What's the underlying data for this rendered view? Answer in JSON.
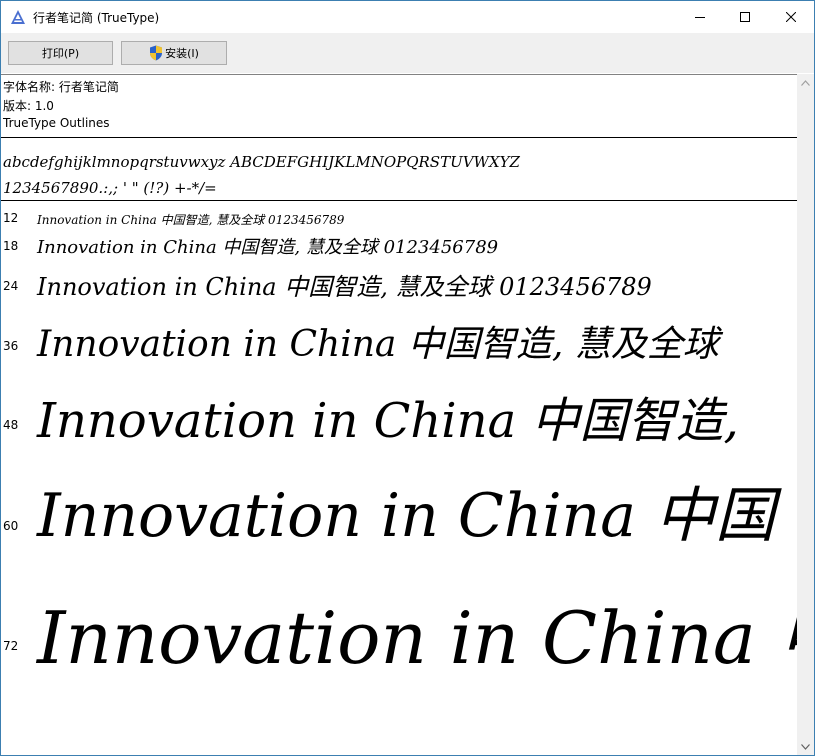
{
  "window": {
    "title": "行者笔记简 (TrueType)",
    "accent_color": "#3c7fb1"
  },
  "toolbar": {
    "print_label": "打印(P)",
    "install_label": "安装(I)"
  },
  "info": {
    "font_name": "字体名称: 行者笔记简",
    "version": "版本: 1.0",
    "outline_type": "TrueType Outlines"
  },
  "charset": {
    "alphabet": "abcdefghijklmnopqrstuvwxyz ABCDEFGHIJKLMNOPQRSTUVWXYZ",
    "digits": "1234567890.:,; ' \" (!?) +-*/="
  },
  "samples": [
    {
      "size": "12",
      "text": "Innovation in China 中国智造, 慧及全球 0123456789"
    },
    {
      "size": "18",
      "text": "Innovation in China 中国智造, 慧及全球 0123456789"
    },
    {
      "size": "24",
      "text": "Innovation in China 中国智造, 慧及全球 0123456789"
    },
    {
      "size": "36",
      "text": "Innovation in China 中国智造, 慧及全球"
    },
    {
      "size": "48",
      "text": "Innovation in China 中国智造,"
    },
    {
      "size": "60",
      "text": "Innovation in China 中国"
    },
    {
      "size": "72",
      "text": "Innovation in China 中"
    }
  ]
}
